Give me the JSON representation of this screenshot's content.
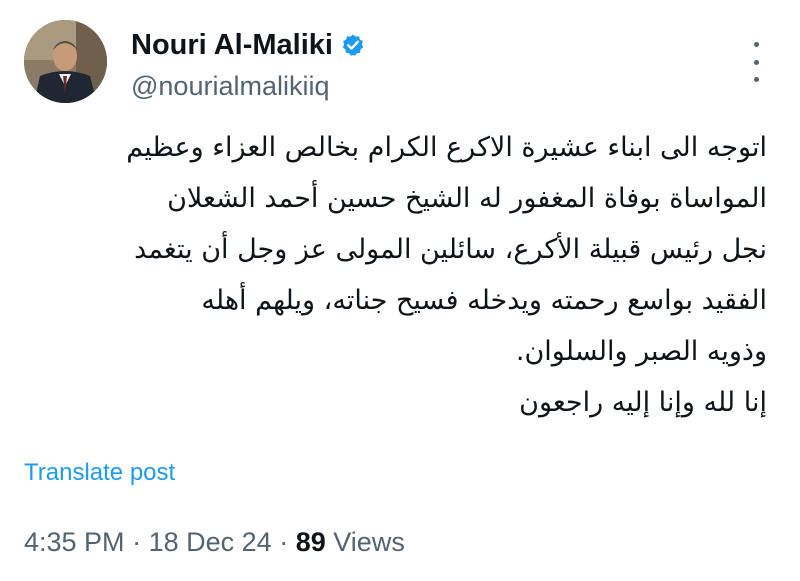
{
  "author": {
    "display_name": "Nouri Al-Maliki",
    "handle": "@nourialmalikiiq",
    "verified": true,
    "verified_color": "#1d9bf0",
    "avatar_icon": "profile-photo"
  },
  "tweet": {
    "lines": [
      "اتوجه الى ابناء عشيرة الاكرع الكرام  بخالص العزاء وعظيم",
      "المواساة بوفاة المغفور له الشيخ حسين أحمد الشعلان",
      "نجل رئيس قبيلة الأكرع، سائلين المولى عز وجل أن يتغمد",
      "الفقيد بواسع رحمته ويدخله فسيح جناته، ويلهم أهله",
      "وذويه الصبر والسلوان.",
      "إنا لله وإنا إليه راجعون"
    ]
  },
  "translate_label": "Translate post",
  "meta": {
    "time": "4:35 PM",
    "separator": "·",
    "date": "18 Dec 24",
    "views_count": "89",
    "views_label": "Views"
  },
  "colors": {
    "text_primary": "#0f1419",
    "text_secondary": "#536471",
    "link": "#1d9bf0"
  }
}
